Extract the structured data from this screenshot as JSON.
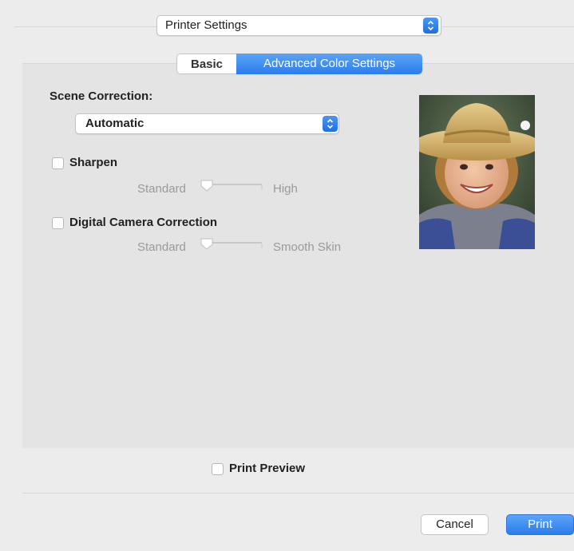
{
  "header": {
    "printer_settings_popup": "Printer Settings"
  },
  "tabs": {
    "basic": "Basic",
    "advanced": "Advanced Color Settings"
  },
  "scene_correction": {
    "label": "Scene Correction:",
    "value": "Automatic"
  },
  "sharpen": {
    "label": "Sharpen",
    "checked": false,
    "min_label": "Standard",
    "max_label": "High"
  },
  "digital_camera_correction": {
    "label": "Digital Camera Correction",
    "checked": false,
    "min_label": "Standard",
    "max_label": "Smooth Skin"
  },
  "preview_image": {
    "description_icon": "photo-preview-image"
  },
  "print_preview": {
    "label": "Print Preview",
    "checked": false
  },
  "footer": {
    "cancel": "Cancel",
    "print": "Print"
  },
  "colors": {
    "accent": "#2c7cec",
    "panel": "#e4e4e4",
    "window": "#ececec"
  }
}
